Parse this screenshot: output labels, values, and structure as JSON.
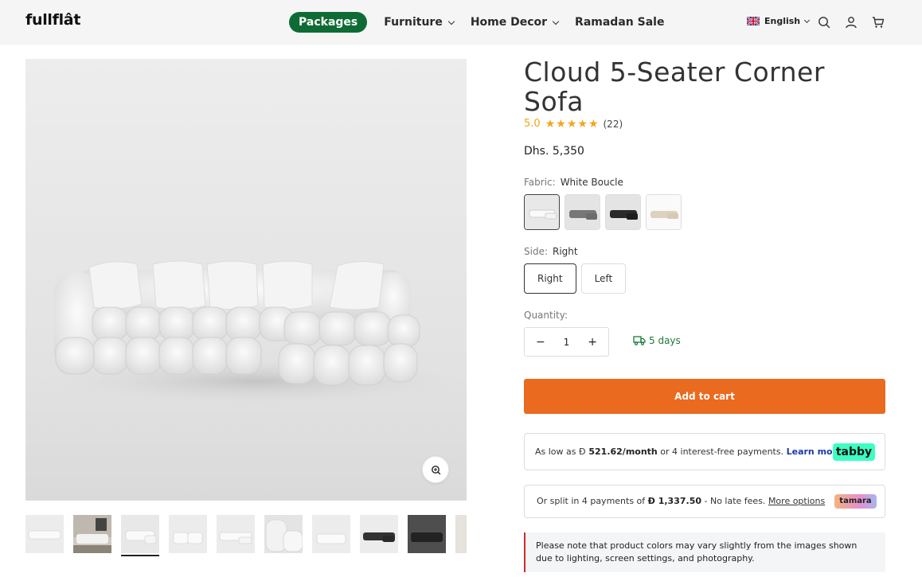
{
  "header": {
    "logo": "fullflât",
    "nav": {
      "packages": "Packages",
      "furniture": "Furniture",
      "home_decor": "Home Decor",
      "ramadan_sale": "Ramadan Sale"
    },
    "language": "English"
  },
  "product": {
    "title": "Cloud 5-Seater Corner Sofa",
    "rating": "5.0",
    "stars_filled": 5,
    "review_count": "(22)",
    "price": "Dhs. 5,350",
    "fabric_label": "Fabric:",
    "fabric_value": "White Boucle",
    "fabric_swatches": [
      "White Boucle",
      "Grey",
      "Black",
      "Beige"
    ],
    "side_label": "Side:",
    "side_value": "Right",
    "side_options": {
      "right": "Right",
      "left": "Left"
    },
    "quantity_label": "Quantity:",
    "quantity": "1",
    "qty_minus": "−",
    "qty_plus": "+",
    "delivery": "5 days",
    "add_to_cart": "Add to cart"
  },
  "tabby": {
    "prefix": "As low as ",
    "currency": "Ð",
    "amount": " 521.62/month",
    "suffix": " or 4 interest-free payments. ",
    "learn_more": "Learn more",
    "badge": "tabby"
  },
  "tamara": {
    "prefix": "Or split in 4 payments of ",
    "amount": "Ð 1,337.50",
    "suffix": " - No late fees. ",
    "more_options": "More options",
    "badge": "tamara"
  },
  "notice": "Please note that product colors may vary slightly from the images shown due to lighting, screen settings, and photography.",
  "colors": {
    "brand_green": "#0f6b34",
    "add_to_cart": "#ea6a1f",
    "star": "#f2a51a",
    "delivery_green": "#1b7a3a",
    "notice_border": "#d22b2b"
  }
}
